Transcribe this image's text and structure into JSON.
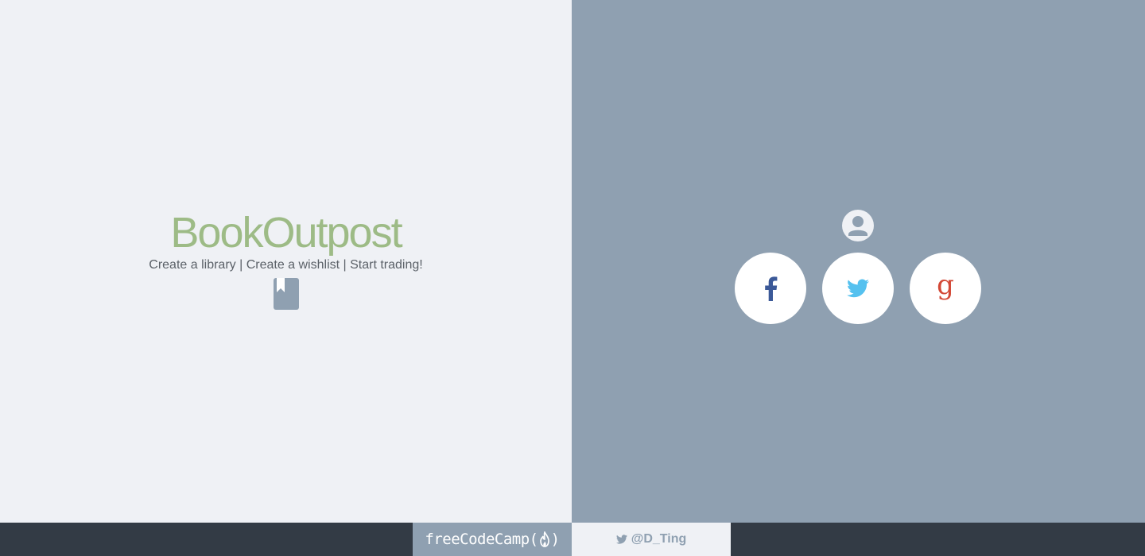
{
  "brand": {
    "title": "BookOutpost",
    "tagline": "Create a library | Create a wishlist | Start trading!"
  },
  "icons": {
    "book": "book-icon",
    "user": "user-circle-icon",
    "facebook": "facebook-icon",
    "twitter": "twitter-icon",
    "google": "google-icon"
  },
  "colors": {
    "left_bg": "#eff1f5",
    "right_bg": "#8fa0b1",
    "brand_green": "#9dbb86",
    "footer_bg": "#333b45",
    "facebook": "#3b5998",
    "twitter": "#55c1ef",
    "google": "#d34836"
  },
  "footer": {
    "fcc_prefix": "freeCodeCamp(",
    "fcc_suffix": ")",
    "twitter_handle": "@D_Ting"
  }
}
